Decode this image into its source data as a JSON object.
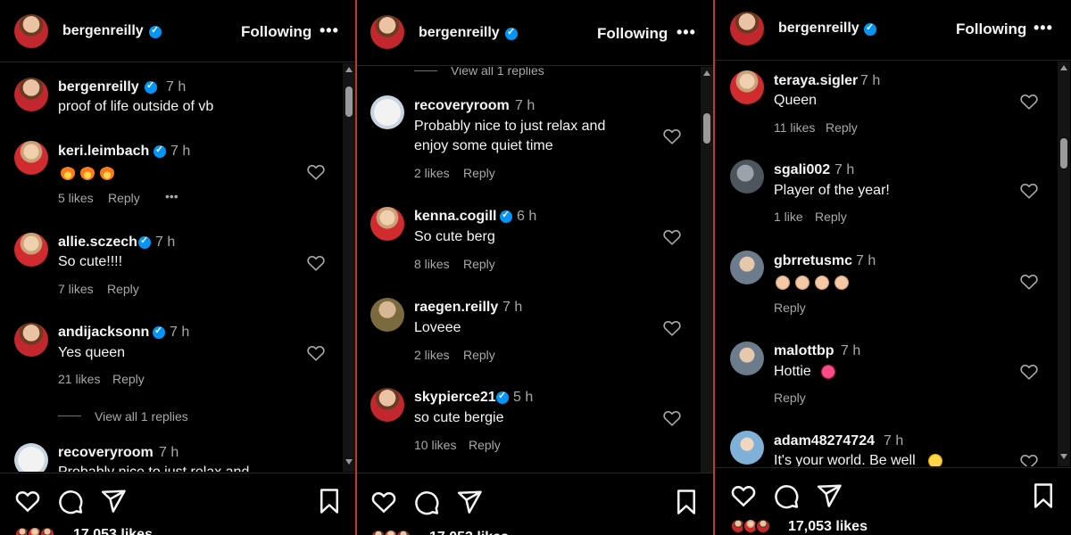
{
  "header": {
    "username": "bergenreilly",
    "following_label": "Following",
    "more_label": "•••"
  },
  "panel1": {
    "comments": [
      {
        "user": "bergenreilly",
        "time": "7 h",
        "text": "proof of life outside of vb"
      },
      {
        "user": "keri.leimbach",
        "time": "7 h",
        "text": "",
        "emoji": "fire-fire-fire",
        "likes": "5 likes",
        "reply": "Reply",
        "more": "•••"
      },
      {
        "user": "allie.sczech",
        "time": "7 h",
        "text": "So cute!!!!",
        "likes": "7 likes",
        "reply": "Reply"
      },
      {
        "user": "andijacksonn",
        "time": "7 h",
        "text": "Yes queen",
        "likes": "21 likes",
        "reply": "Reply"
      },
      {
        "user": "recoveryroom",
        "time": "7 h",
        "text": "Probably nice to just relax and"
      }
    ],
    "view_all": "View all 1 replies"
  },
  "panel2": {
    "view_all_top": "View all 1 replies",
    "comments": [
      {
        "user": "recoveryroom",
        "time": "7 h",
        "text1": "Probably nice to just relax and",
        "text2": "enjoy some quiet time",
        "likes": "2 likes",
        "reply": "Reply"
      },
      {
        "user": "kenna.cogill",
        "time": "6 h",
        "text": "So cute berg",
        "likes": "8 likes",
        "reply": "Reply"
      },
      {
        "user": "raegen.reilly",
        "time": "7 h",
        "text": "Loveee",
        "likes": "2 likes",
        "reply": "Reply"
      },
      {
        "user": "skypierce21",
        "time": "5 h",
        "text": "so cute bergie",
        "likes": "10 likes",
        "reply": "Reply"
      }
    ]
  },
  "panel3": {
    "comments": [
      {
        "user": "teraya.sigler",
        "time": "7 h",
        "text": "Queen",
        "likes": "11 likes",
        "reply": "Reply"
      },
      {
        "user": "sgali002",
        "time": "7 h",
        "text": "Player of the year!",
        "likes": "1 like",
        "reply": "Reply"
      },
      {
        "user": "gbrretusmc",
        "time": "7 h",
        "text": "",
        "emoji": "clap-clap-clap-clap",
        "reply": "Reply"
      },
      {
        "user": "malottbp",
        "time": "7 h",
        "text": "Hottie",
        "emoji": "smile",
        "reply": "Reply"
      },
      {
        "user": "adam48274724",
        "time": "7 h",
        "text": "It's your world. Be well",
        "emoji": "hands"
      }
    ]
  },
  "footer": {
    "likes": "17,053 likes"
  },
  "colors": {
    "background": "#000000",
    "verified": "#0095f6",
    "divider": "#c0392b",
    "secondary_text": "#a8a8a8"
  },
  "icons": [
    "heart-icon",
    "comment-icon",
    "share-icon",
    "bookmark-icon",
    "verified-icon",
    "more-icon"
  ]
}
